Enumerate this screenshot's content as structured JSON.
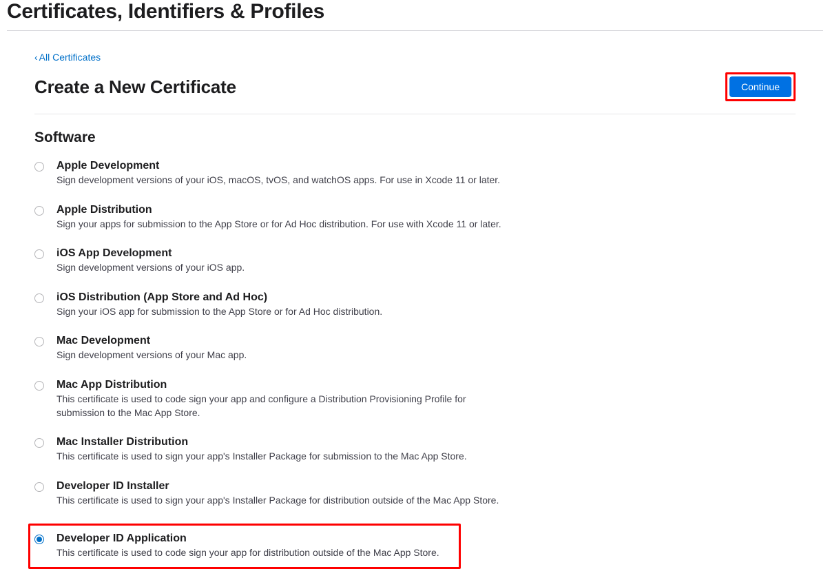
{
  "header": {
    "page_title": "Certificates, Identifiers & Profiles"
  },
  "back_link": {
    "label": "All Certificates"
  },
  "title_row": {
    "heading": "Create a New Certificate",
    "continue_label": "Continue"
  },
  "section": {
    "title": "Software"
  },
  "options": [
    {
      "title": "Apple Development",
      "desc": "Sign development versions of your iOS, macOS, tvOS, and watchOS apps. For use in Xcode 11 or later.",
      "selected": false,
      "highlighted": false
    },
    {
      "title": "Apple Distribution",
      "desc": "Sign your apps for submission to the App Store or for Ad Hoc distribution. For use with Xcode 11 or later.",
      "selected": false,
      "highlighted": false
    },
    {
      "title": "iOS App Development",
      "desc": "Sign development versions of your iOS app.",
      "selected": false,
      "highlighted": false
    },
    {
      "title": "iOS Distribution (App Store and Ad Hoc)",
      "desc": "Sign your iOS app for submission to the App Store or for Ad Hoc distribution.",
      "selected": false,
      "highlighted": false
    },
    {
      "title": "Mac Development",
      "desc": "Sign development versions of your Mac app.",
      "selected": false,
      "highlighted": false
    },
    {
      "title": "Mac App Distribution",
      "desc": "This certificate is used to code sign your app and configure a Distribution Provisioning Profile for submission to the Mac App Store.",
      "selected": false,
      "highlighted": false
    },
    {
      "title": "Mac Installer Distribution",
      "desc": "This certificate is used to sign your app's Installer Package for submission to the Mac App Store.",
      "selected": false,
      "highlighted": false
    },
    {
      "title": "Developer ID Installer",
      "desc": "This certificate is used to sign your app's Installer Package for distribution outside of the Mac App Store.",
      "selected": false,
      "highlighted": false
    },
    {
      "title": "Developer ID Application",
      "desc": "This certificate is used to code sign your app for distribution outside of the Mac App Store.",
      "selected": true,
      "highlighted": true
    }
  ]
}
